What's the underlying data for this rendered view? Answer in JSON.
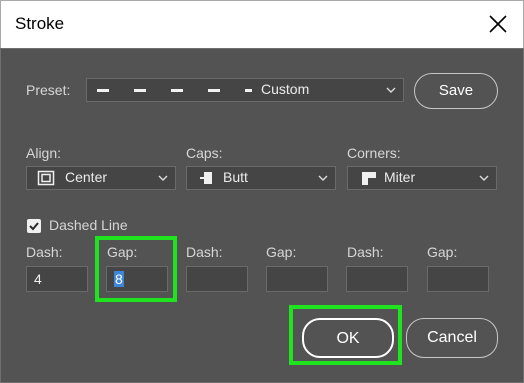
{
  "window": {
    "title": "Stroke"
  },
  "preset": {
    "label": "Preset:",
    "value": "Custom",
    "save_label": "Save"
  },
  "align": {
    "label": "Align:",
    "value": "Center"
  },
  "caps": {
    "label": "Caps:",
    "value": "Butt"
  },
  "corners": {
    "label": "Corners:",
    "value": "Miter"
  },
  "dashed_line": {
    "label": "Dashed Line",
    "checked": true
  },
  "pattern": [
    {
      "label": "Dash:",
      "value": "4"
    },
    {
      "label": "Gap:",
      "value": "8"
    },
    {
      "label": "Dash:",
      "value": ""
    },
    {
      "label": "Gap:",
      "value": ""
    },
    {
      "label": "Dash:",
      "value": ""
    },
    {
      "label": "Gap:",
      "value": ""
    }
  ],
  "buttons": {
    "ok_label": "OK",
    "cancel_label": "Cancel"
  },
  "colors": {
    "dialog_bg": "#535353",
    "field_bg": "#454545",
    "highlight": "#1ee31e",
    "selection": "#3d86d8"
  },
  "icons": [
    "close-icon",
    "chevron-down-icon",
    "align-center-icon",
    "caps-butt-icon",
    "corners-miter-icon",
    "checkmark-icon"
  ]
}
